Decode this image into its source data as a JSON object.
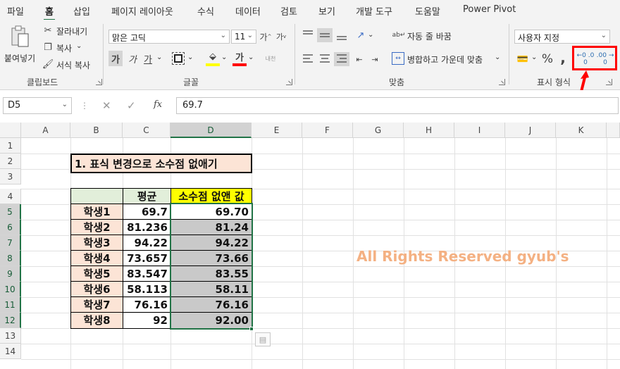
{
  "menu": {
    "tabs": [
      "파일",
      "홈",
      "삽입",
      "페이지 레이아웃",
      "수식",
      "데이터",
      "검토",
      "보기",
      "개발 도구",
      "도움말",
      "Power Pivot"
    ],
    "active": "홈"
  },
  "ribbon": {
    "clipboard": {
      "paste_label": "붙여넣기",
      "cut_label": "잘라내기",
      "copy_label": "복사",
      "format_painter_label": "서식 복사",
      "group_label": "클립보드"
    },
    "font": {
      "font_name": "맑은 고딕",
      "font_size": "11",
      "group_label": "글꼴",
      "bold_glyph": "가",
      "italic_glyph": "가",
      "underline_glyph": "가",
      "grow_glyph": "가",
      "shrink_glyph": "가",
      "font_color_glyph": "가",
      "phonetic_glyph": "내천"
    },
    "alignment": {
      "wrap_text_label": "자동 줄 바꿈",
      "merge_center_label": "병합하고 가운데 맞춤",
      "group_label": "맞춤"
    },
    "number": {
      "format_value": "사용자 지정",
      "percent_glyph": "%",
      "comma_glyph": ",",
      "increase_decimal_text": "←0 .00",
      "decrease_decimal_text": ".00 →0",
      "group_label": "표시 형식"
    },
    "colors": {
      "highlight": "#ff0000",
      "fill_yellow": "#ffff00",
      "font_red": "#ff0000"
    }
  },
  "formula_bar": {
    "name_box": "D5",
    "cancel_glyph": "✕",
    "confirm_glyph": "✓",
    "fx_glyph": "fx",
    "value": "69.7"
  },
  "sheet": {
    "columns": [
      "A",
      "B",
      "C",
      "D",
      "E",
      "F",
      "G",
      "H",
      "I",
      "J",
      "K"
    ],
    "rows": [
      "1",
      "2",
      "3",
      "4",
      "5",
      "6",
      "7",
      "8",
      "9",
      "10",
      "11",
      "12",
      "13",
      "14"
    ],
    "selected_cell": "D5",
    "title": "1. 표식 변경으로 소수점 없애기",
    "table_headers": {
      "b": "",
      "c": "평균",
      "d": "소수점 없앤 값"
    },
    "students": [
      {
        "name": "학생1",
        "avg": "69.7",
        "rounded": "69.70"
      },
      {
        "name": "학생2",
        "avg": "81.236",
        "rounded": "81.24"
      },
      {
        "name": "학생3",
        "avg": "94.22",
        "rounded": "94.22"
      },
      {
        "name": "학생4",
        "avg": "73.657",
        "rounded": "73.66"
      },
      {
        "name": "학생5",
        "avg": "83.547",
        "rounded": "83.55"
      },
      {
        "name": "학생6",
        "avg": "58.113",
        "rounded": "58.11"
      },
      {
        "name": "학생7",
        "avg": "76.16",
        "rounded": "76.16"
      },
      {
        "name": "학생8",
        "avg": "92",
        "rounded": "92.00"
      }
    ],
    "watermark": "All Rights Reserved gyub's",
    "colors": {
      "name_fill": "#fce4d6",
      "header_b_fill": "#e2efda",
      "header_d_fill": "#ffff00",
      "title_fill": "#fce4d6",
      "selected_fill": "#c9c9c9",
      "accent": "#217346",
      "watermark": "#f4b183"
    }
  }
}
